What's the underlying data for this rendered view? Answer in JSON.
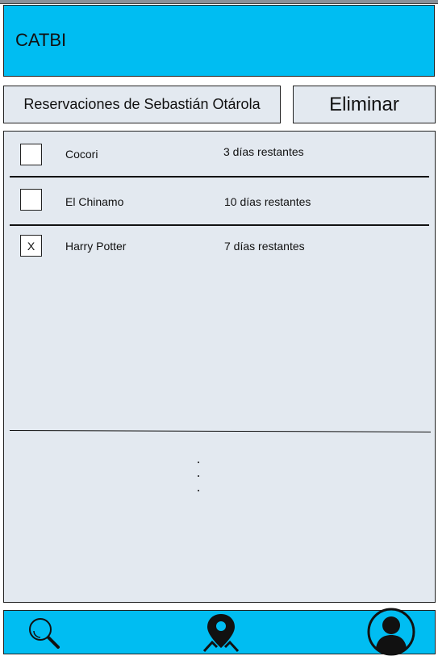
{
  "app": {
    "title": "CATBI"
  },
  "header": {
    "reservations_label": "Reservaciones de  Sebastián Otárola",
    "delete_label": "Eliminar"
  },
  "reservations": [
    {
      "title": "Cocori",
      "days": "3 días restantes",
      "checked": false,
      "mark": ""
    },
    {
      "title": "El Chinamo",
      "days": "10 días restantes",
      "checked": false,
      "mark": ""
    },
    {
      "title": "Harry Potter",
      "days": "7 días restantes",
      "checked": true,
      "mark": "X"
    }
  ],
  "more_indicator": ". . .",
  "nav": {
    "items": [
      {
        "name": "search-icon"
      },
      {
        "name": "map-pin-icon"
      },
      {
        "name": "user-profile-icon"
      }
    ]
  },
  "colors": {
    "accent": "#00bdf2",
    "panel": "#e3e9f0"
  }
}
